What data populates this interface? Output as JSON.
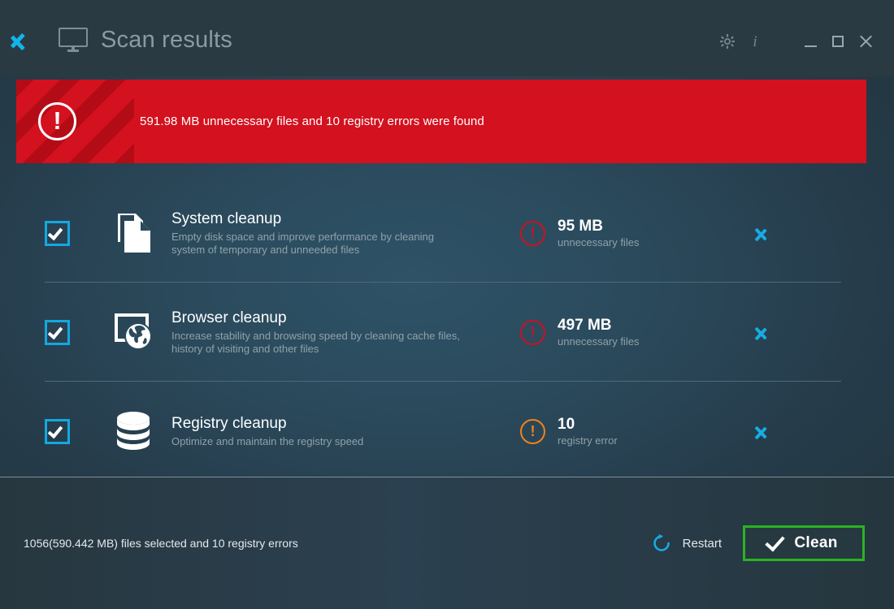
{
  "window": {
    "title": "Scan results",
    "back_icon": "chevron-left-icon",
    "app_icon": "monitor-icon",
    "controls": {
      "settings": "gear-icon",
      "info": "info-icon",
      "minimize": "minimize-icon",
      "maximize": "maximize-icon",
      "close": "close-icon"
    }
  },
  "banner": {
    "icon": "alert-exclamation-icon",
    "message": "591.98 MB unnecessary files and 10 registry errors were found",
    "background_color": "#d4111e",
    "stripe_color": "#b30c17"
  },
  "rows": [
    {
      "checked": true,
      "icon": "documents-icon",
      "title": "System cleanup",
      "description": "Empty disk space and improve performance by cleaning system of temporary and unneeded files",
      "status_icon": "alert-exclamation-icon",
      "status_color": "#cc1122",
      "value": "95 MB",
      "label": "unnecessary files",
      "chevron": "chevron-right-icon"
    },
    {
      "checked": true,
      "icon": "browser-globe-icon",
      "title": "Browser cleanup",
      "description": "Increase stability and browsing speed by cleaning cache files, history of visiting and other files",
      "status_icon": "alert-exclamation-icon",
      "status_color": "#cc1122",
      "value": "497 MB",
      "label": "unnecessary files",
      "chevron": "chevron-right-icon"
    },
    {
      "checked": true,
      "icon": "database-icon",
      "title": "Registry cleanup",
      "description": "Optimize and maintain the registry speed",
      "status_icon": "alert-exclamation-icon",
      "status_color": "#f0821a",
      "value": "10",
      "label": "registry error",
      "chevron": "chevron-right-icon"
    }
  ],
  "footer": {
    "status": "1056(590.442 MB) files selected and 10 registry errors",
    "restart_label": "Restart",
    "restart_icon": "refresh-icon",
    "clean_label": "Clean",
    "clean_icon": "check-icon",
    "clean_border_color": "#2ab322"
  },
  "theme": {
    "accent_cyan": "#14a8e0",
    "background_dark": "#25363f",
    "background_mid": "#2e5267"
  }
}
